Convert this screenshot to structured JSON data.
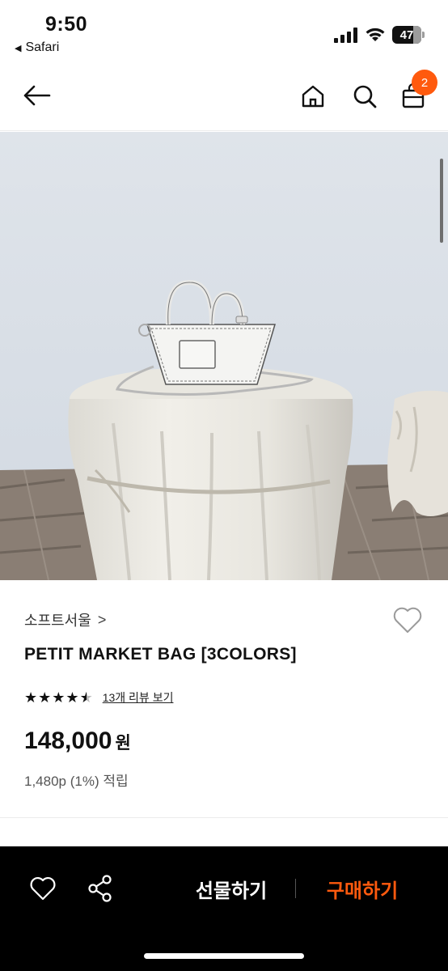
{
  "status_bar": {
    "time": "9:50",
    "back_app_label": "Safari",
    "battery_level": "47"
  },
  "header": {
    "back_icon": "arrow-left-icon",
    "home_icon": "home-icon",
    "search_icon": "search-icon",
    "cart_icon": "shopping-bag-icon",
    "cart_count": "2"
  },
  "product": {
    "brand": "소프트서울",
    "brand_chevron": ">",
    "title": "PETIT MARKET BAG [3COLORS]",
    "rating_stars": 4.5,
    "review_link": "13개 리뷰 보기",
    "price": "148,000",
    "currency": "원",
    "points": "1,480p (1%) 적립"
  },
  "bottom_bar": {
    "wish_icon": "heart-outline-icon",
    "share_icon": "share-icon",
    "gift_label": "선물하기",
    "buy_label": "구매하기"
  },
  "colors": {
    "accent": "#ff5a0e",
    "bottom_bar_bg": "#000000",
    "text": "#111111"
  }
}
